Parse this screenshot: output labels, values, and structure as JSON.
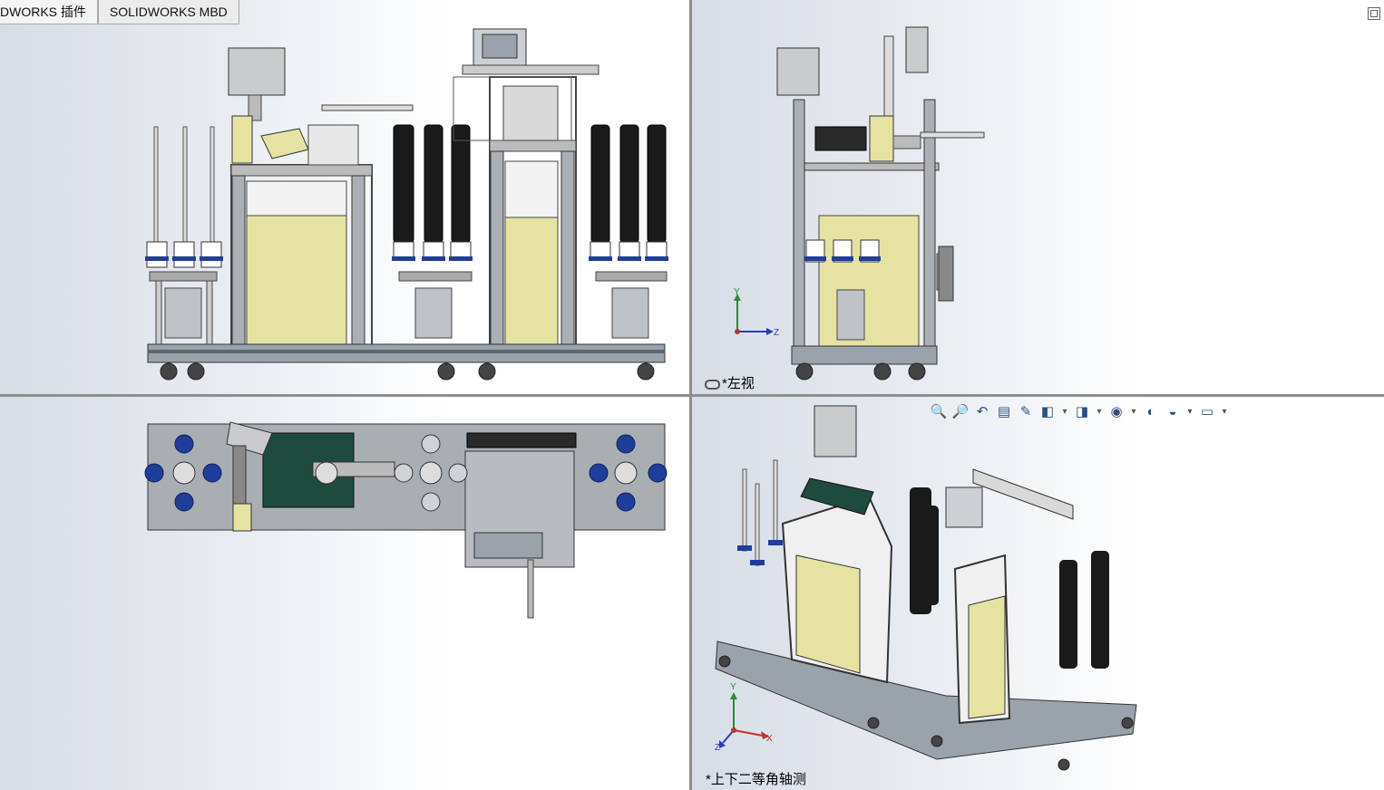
{
  "tabs": [
    {
      "label": "DWORKS 插件"
    },
    {
      "label": "SOLIDWORKS MBD"
    }
  ],
  "viewports": {
    "left_view": {
      "label": "*左视"
    },
    "iso_view": {
      "label": "*上下二等角轴测"
    }
  },
  "triad_left": {
    "y": "Y",
    "z": "Z"
  },
  "triad_iso": {
    "y": "Y",
    "x": "X",
    "z": "Z"
  },
  "heads_up_toolbar": [
    {
      "name": "zoom-to-fit-icon",
      "glyph": "🔍"
    },
    {
      "name": "zoom-to-area-icon",
      "glyph": "🔎"
    },
    {
      "name": "previous-view-icon",
      "glyph": "↶"
    },
    {
      "name": "section-view-icon",
      "glyph": "▤"
    },
    {
      "name": "dynamic-annotation-icon",
      "glyph": "✎"
    },
    {
      "name": "view-orientation-icon",
      "glyph": "◧"
    },
    {
      "name": "display-style-icon",
      "glyph": "◨"
    },
    {
      "name": "hide-show-items-icon",
      "glyph": "◉"
    },
    {
      "name": "edit-appearance-icon",
      "glyph": "◐"
    },
    {
      "name": "apply-scene-icon",
      "glyph": "◒"
    },
    {
      "name": "view-settings-icon",
      "glyph": "▭"
    }
  ],
  "colors": {
    "frame": "#9aa3ab",
    "frame_dark": "#5e666e",
    "panel_yellow": "#e6e3a2",
    "bellow_black": "#1a1a1a",
    "blue_roller": "#1f3e9c",
    "green_belt": "#1f4a3e"
  }
}
